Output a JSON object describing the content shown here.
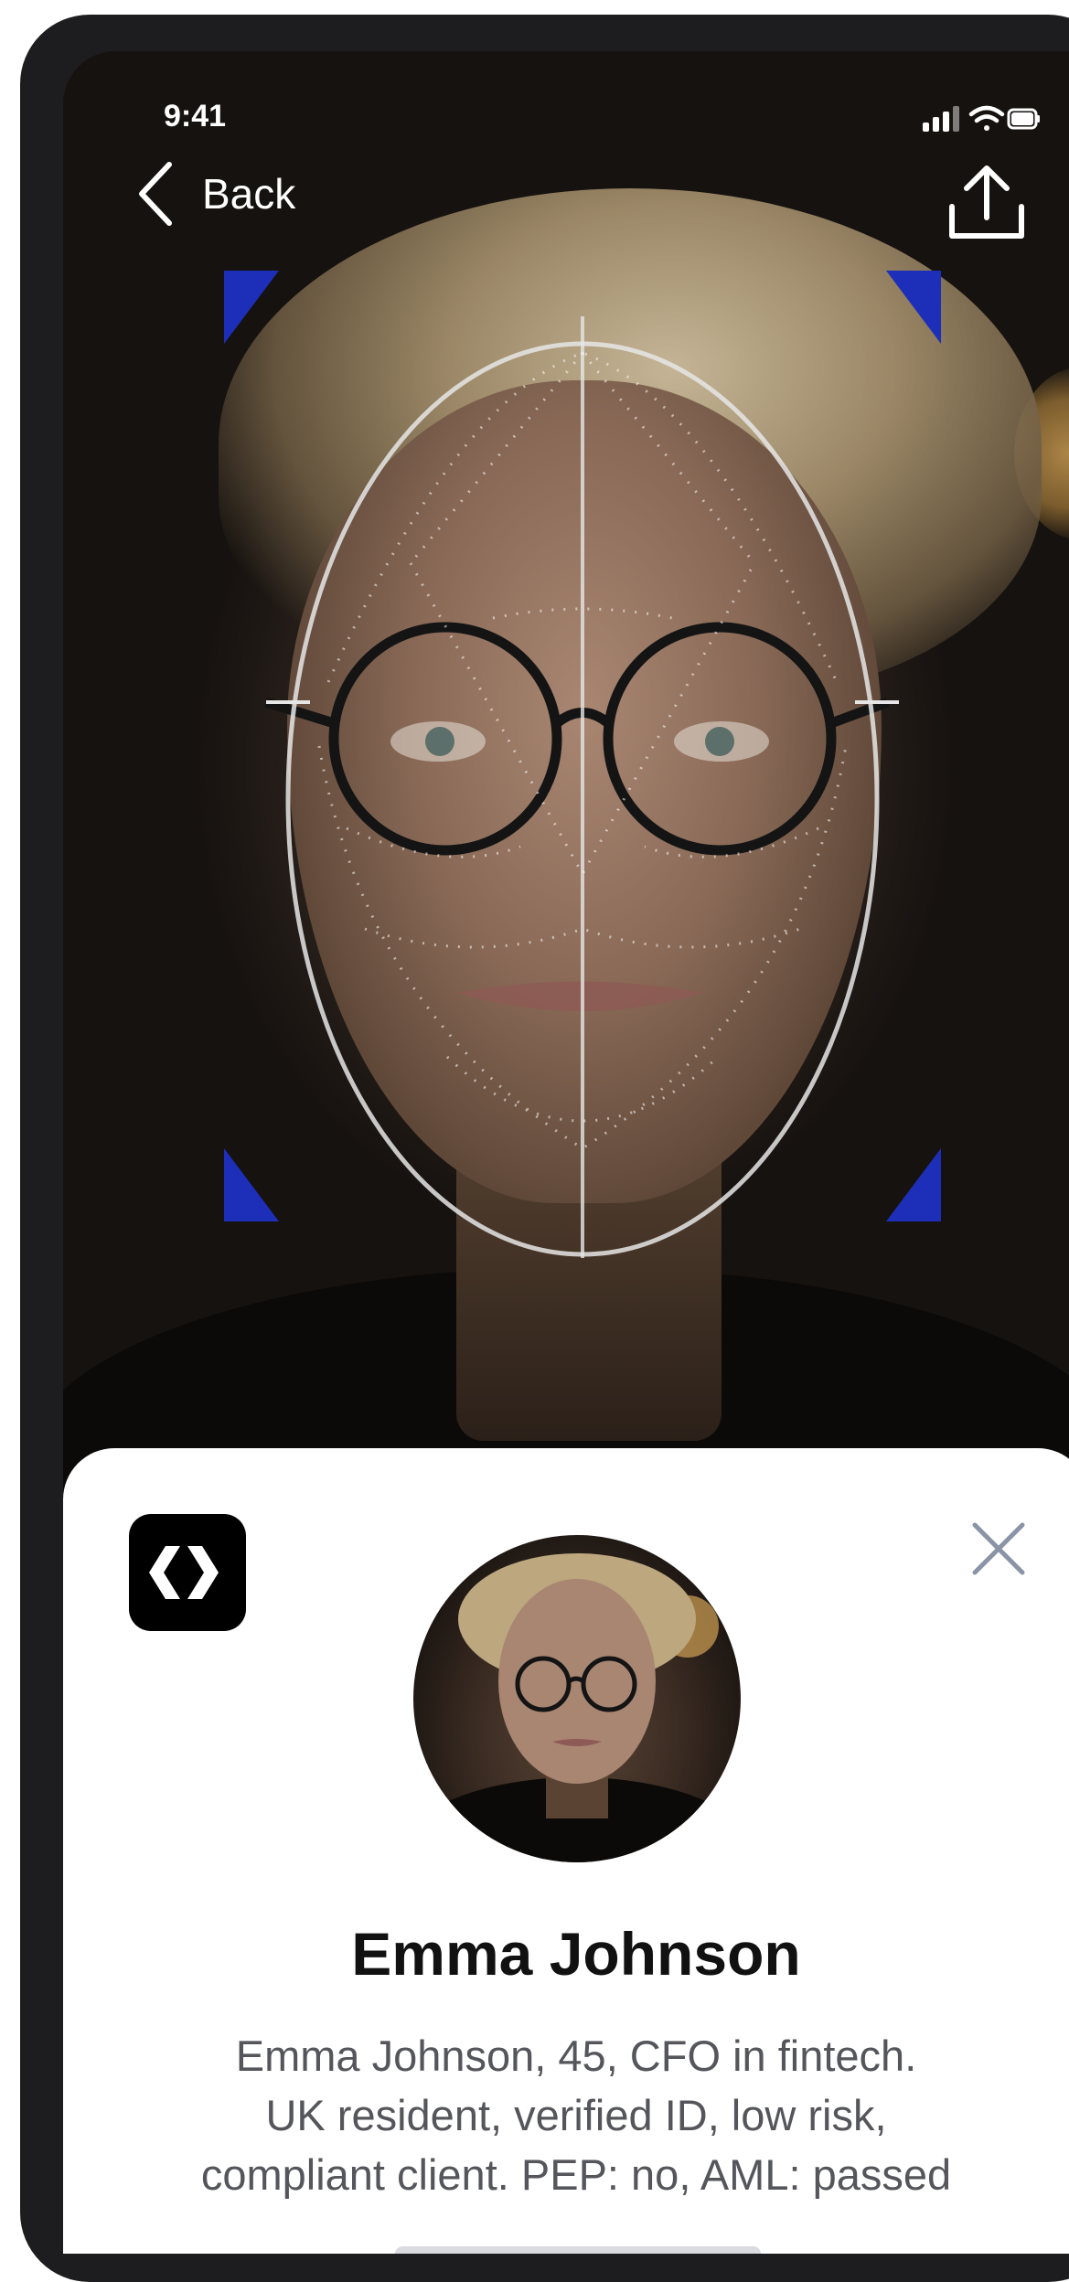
{
  "status_bar": {
    "time": "9:41"
  },
  "nav": {
    "back_label": "Back"
  },
  "profile": {
    "name": "Emma Johnson",
    "description_lines": [
      "Emma Johnson, 45, CFO in fintech.",
      "UK resident, verified ID, low risk,",
      "compliant client. PEP: no, AML: passed"
    ]
  },
  "colors": {
    "scan_corner": "#1d2fb8",
    "overlay_line": "#e6e6e6",
    "sheet_background": "#ffffff",
    "close_icon": "#8a94a6"
  },
  "icons": {
    "back": "chevron-left-icon",
    "share": "share-icon",
    "logo": "app-logo-icon",
    "close": "close-icon"
  }
}
